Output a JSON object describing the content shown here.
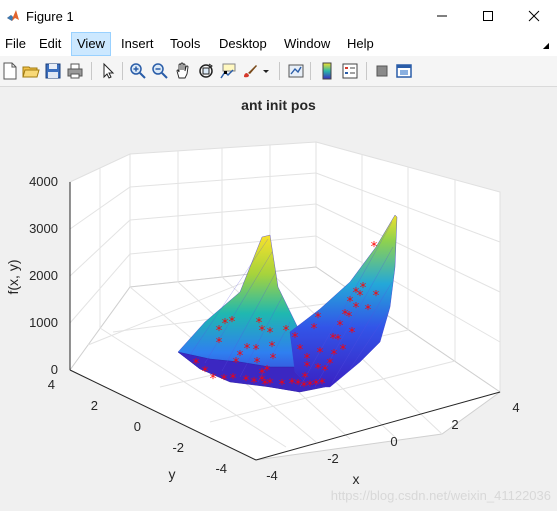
{
  "window": {
    "title": "Figure 1"
  },
  "menu": {
    "items": [
      "File",
      "Edit",
      "View",
      "Insert",
      "Tools",
      "Desktop",
      "Window",
      "Help"
    ],
    "active": "View"
  },
  "toolbar": {
    "icons": [
      "new-figure-icon",
      "open-file-icon",
      "save-icon",
      "print-icon",
      "pointer-icon",
      "zoom-in-icon",
      "zoom-out-icon",
      "pan-icon",
      "rotate-3d-icon",
      "data-cursor-icon",
      "brush-icon",
      "link-plot-icon",
      "colorbar-icon",
      "legend-icon",
      "hide-plot-tools-icon",
      "show-plot-tools-icon"
    ]
  },
  "colors": {
    "accent_active_menu": "#cce8ff",
    "marker": "#ff0000"
  },
  "chart_data": {
    "type": "surface",
    "title": "ant init pos",
    "xlabel": "x",
    "ylabel": "y",
    "zlabel": "f(x, y)",
    "xlim": [
      -4,
      4
    ],
    "ylim": [
      -4,
      4
    ],
    "zlim": [
      0,
      4000
    ],
    "xticks": [
      "-4",
      "-2",
      "0",
      "2",
      "4"
    ],
    "yticks": [
      "4",
      "2",
      "0",
      "-2",
      "-4"
    ],
    "zticks": [
      "4000",
      "3000",
      "2000",
      "1000",
      "0"
    ],
    "grid": true,
    "series": [
      {
        "type": "surface",
        "values": []
      },
      {
        "type": "scatter3",
        "marker": "*"
      }
    ]
  },
  "watermark": "https://blog.csdn.net/weixin_41122036"
}
